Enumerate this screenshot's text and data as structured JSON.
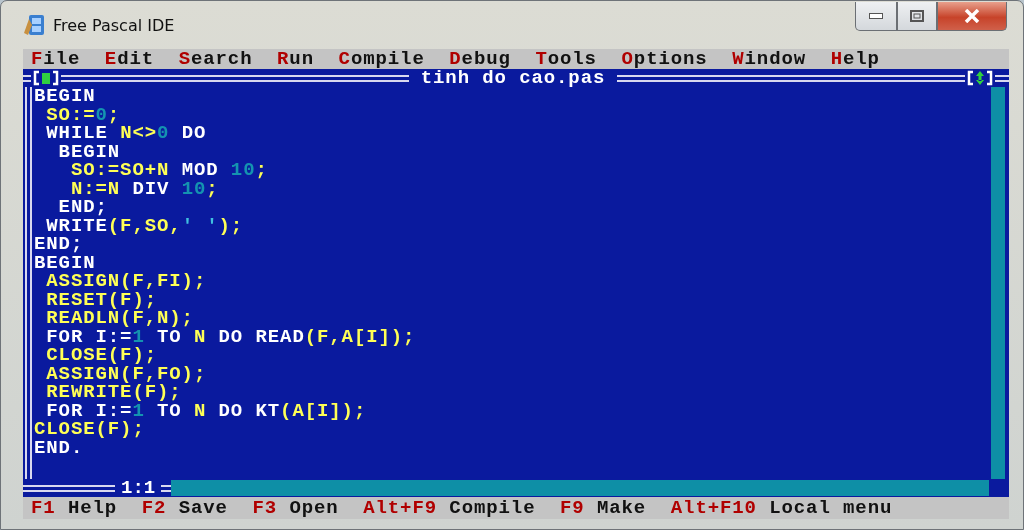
{
  "window": {
    "title": "Free Pascal IDE"
  },
  "menu": [
    {
      "label": "File"
    },
    {
      "label": "Edit"
    },
    {
      "label": "Search"
    },
    {
      "label": "Run"
    },
    {
      "label": "Compile"
    },
    {
      "label": "Debug"
    },
    {
      "label": "Tools"
    },
    {
      "label": "Options"
    },
    {
      "label": "Window"
    },
    {
      "label": "Help"
    }
  ],
  "editor": {
    "title": "tinh do cao.pas",
    "cursor_position": "1:1",
    "lines": [
      {
        "tokens": [
          {
            "text": "BEGIN",
            "kind": "keyword"
          }
        ]
      },
      {
        "tokens": [
          {
            "text": " SO:=",
            "kind": "ident"
          },
          {
            "text": "0",
            "kind": "number"
          },
          {
            "text": ";",
            "kind": "ident"
          }
        ]
      },
      {
        "tokens": [
          {
            "text": " WHILE ",
            "kind": "keyword"
          },
          {
            "text": "N<>",
            "kind": "ident"
          },
          {
            "text": "0",
            "kind": "number"
          },
          {
            "text": " DO",
            "kind": "keyword"
          }
        ]
      },
      {
        "tokens": [
          {
            "text": "  BEGIN",
            "kind": "keyword"
          }
        ]
      },
      {
        "tokens": [
          {
            "text": "   SO:=SO+N",
            "kind": "ident"
          },
          {
            "text": " MOD ",
            "kind": "keyword"
          },
          {
            "text": "10",
            "kind": "number"
          },
          {
            "text": ";",
            "kind": "ident"
          }
        ]
      },
      {
        "tokens": [
          {
            "text": "   N:=N",
            "kind": "ident"
          },
          {
            "text": " DIV ",
            "kind": "keyword"
          },
          {
            "text": "10",
            "kind": "number"
          },
          {
            "text": ";",
            "kind": "ident"
          }
        ]
      },
      {
        "tokens": [
          {
            "text": "  END;",
            "kind": "keyword"
          }
        ]
      },
      {
        "tokens": [
          {
            "text": " WRITE",
            "kind": "keyword"
          },
          {
            "text": "(F,SO,",
            "kind": "ident"
          },
          {
            "text": "' '",
            "kind": "string"
          },
          {
            "text": ");",
            "kind": "ident"
          }
        ]
      },
      {
        "tokens": [
          {
            "text": "END;",
            "kind": "keyword"
          }
        ]
      },
      {
        "tokens": [
          {
            "text": "BEGIN",
            "kind": "keyword"
          }
        ]
      },
      {
        "tokens": [
          {
            "text": " ASSIGN(F,FI);",
            "kind": "ident"
          }
        ]
      },
      {
        "tokens": [
          {
            "text": " RESET(F);",
            "kind": "ident"
          }
        ]
      },
      {
        "tokens": [
          {
            "text": " READLN(F,N);",
            "kind": "ident"
          }
        ]
      },
      {
        "tokens": [
          {
            "text": " FOR I:=",
            "kind": "keyword"
          },
          {
            "text": "1",
            "kind": "number"
          },
          {
            "text": " TO ",
            "kind": "keyword"
          },
          {
            "text": "N",
            "kind": "ident"
          },
          {
            "text": " DO READ",
            "kind": "keyword"
          },
          {
            "text": "(F,A[I]);",
            "kind": "ident"
          }
        ]
      },
      {
        "tokens": [
          {
            "text": " CLOSE(F);",
            "kind": "ident"
          }
        ]
      },
      {
        "tokens": [
          {
            "text": " ASSIGN(F,FO);",
            "kind": "ident"
          }
        ]
      },
      {
        "tokens": [
          {
            "text": " REWRITE(F);",
            "kind": "ident"
          }
        ]
      },
      {
        "tokens": [
          {
            "text": " FOR I:=",
            "kind": "keyword"
          },
          {
            "text": "1",
            "kind": "number"
          },
          {
            "text": " TO ",
            "kind": "keyword"
          },
          {
            "text": "N",
            "kind": "ident"
          },
          {
            "text": " DO KT",
            "kind": "keyword"
          },
          {
            "text": "(A[I]);",
            "kind": "ident"
          }
        ]
      },
      {
        "tokens": [
          {
            "text": "CLOSE(F);",
            "kind": "ident"
          }
        ]
      },
      {
        "tokens": [
          {
            "text": "END.",
            "kind": "keyword"
          }
        ]
      }
    ]
  },
  "status_bar": [
    {
      "key": "F1",
      "label": "Help"
    },
    {
      "key": "F2",
      "label": "Save"
    },
    {
      "key": "F3",
      "label": "Open"
    },
    {
      "key": "Alt+F9",
      "label": "Compile"
    },
    {
      "key": "F9",
      "label": "Make"
    },
    {
      "key": "Alt+F10",
      "label": "Local menu"
    }
  ]
}
